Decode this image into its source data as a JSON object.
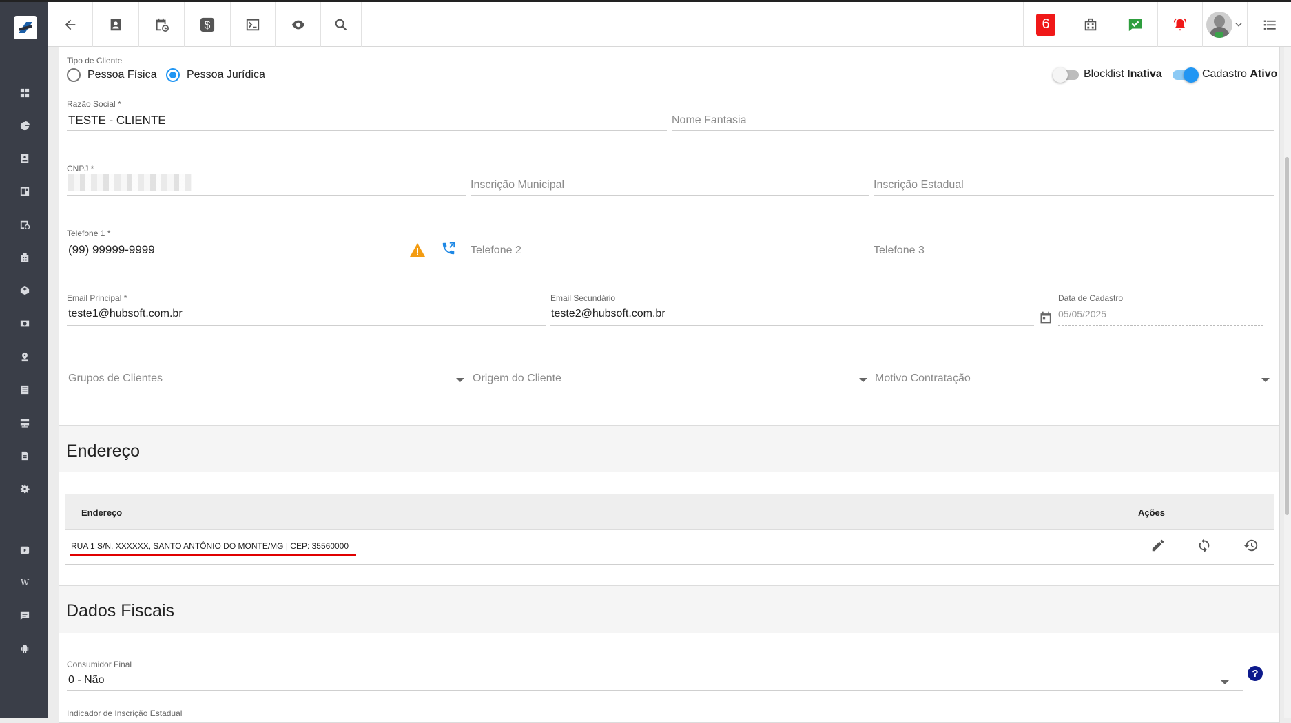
{
  "topbar": {
    "notification_count": "6"
  },
  "client_form": {
    "tipo_cliente_label": "Tipo de Cliente",
    "pessoa_fisica": "Pessoa Física",
    "pessoa_juridica": "Pessoa Jurídica",
    "blocklist_label": "Blocklist",
    "blocklist_status": "Inativa",
    "cadastro_label": "Cadastro",
    "cadastro_status": "Ativo",
    "razao_social_label": "Razão Social *",
    "razao_social_value": "TESTE - CLIENTE",
    "nome_fantasia_placeholder": "Nome Fantasia",
    "cnpj_label": "CNPJ *",
    "inscricao_municipal_placeholder": "Inscrição Municipal",
    "inscricao_estadual_placeholder": "Inscrição Estadual",
    "telefone1_label": "Telefone 1 *",
    "telefone1_value": "(99) 99999-9999",
    "telefone2_placeholder": "Telefone 2",
    "telefone3_placeholder": "Telefone 3",
    "email_principal_label": "Email Principal *",
    "email_principal_value": "teste1@hubsoft.com.br",
    "email_secundario_label": "Email Secundário",
    "email_secundario_value": "teste2@hubsoft.com.br",
    "data_cadastro_label": "Data de Cadastro",
    "data_cadastro_value": "05/05/2025",
    "grupos_placeholder": "Grupos de Clientes",
    "origem_placeholder": "Origem do Cliente",
    "motivo_placeholder": "Motivo Contratação"
  },
  "endereco": {
    "title": "Endereço",
    "col_endereco": "Endereço",
    "col_acoes": "Ações",
    "rows": [
      {
        "address": "RUA 1 S/N, XXXXXX, SANTO ANTÔNIO DO MONTE/MG | CEP: 35560000"
      }
    ]
  },
  "fiscal": {
    "title": "Dados Fiscais",
    "consumidor_label": "Consumidor Final",
    "consumidor_value": "0 - Não",
    "indicador_label": "Indicador de Inscrição Estadual"
  },
  "colors": {
    "accent": "#2196f3",
    "sidebar": "#3a3e48",
    "alert_red": "#f01818",
    "warning": "#f39c12",
    "underline_red": "#e00000"
  }
}
